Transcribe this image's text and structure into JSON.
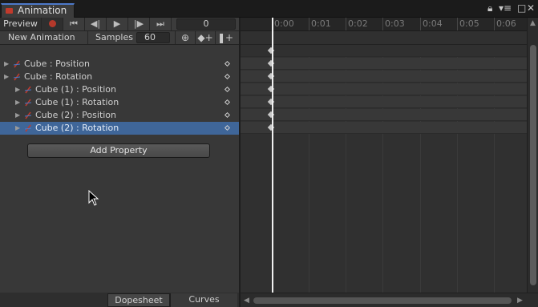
{
  "window": {
    "tab_title": "Animation",
    "menu_icons": [
      "lock-icon",
      "menu-icon",
      "maximize-icon",
      "close-icon"
    ]
  },
  "toolbar": {
    "preview_label": "Preview",
    "record_icon": "record-icon",
    "frame_value": "0",
    "clip_name": "New Animation",
    "samples_label": "Samples",
    "samples_value": "60"
  },
  "properties": [
    {
      "label": "Cube : Position",
      "indent": 0,
      "selected": false
    },
    {
      "label": "Cube : Rotation",
      "indent": 0,
      "selected": false
    },
    {
      "label": "Cube (1) : Position",
      "indent": 1,
      "selected": false
    },
    {
      "label": "Cube (1) : Rotation",
      "indent": 1,
      "selected": false
    },
    {
      "label": "Cube (2) : Position",
      "indent": 1,
      "selected": false
    },
    {
      "label": "Cube (2) : Rotation",
      "indent": 1,
      "selected": true
    }
  ],
  "add_property_label": "Add Property",
  "bottom_tabs": {
    "dopesheet": "Dopesheet",
    "curves": "Curves"
  },
  "timeline": {
    "labels": [
      "0:00",
      "0:01",
      "0:02",
      "0:03",
      "0:04",
      "0:05",
      "0:06"
    ],
    "current_frame": 0
  },
  "colors": {
    "selection": "#3f6699",
    "record": "#b5392b",
    "tab_accent": "#4d79c9"
  }
}
